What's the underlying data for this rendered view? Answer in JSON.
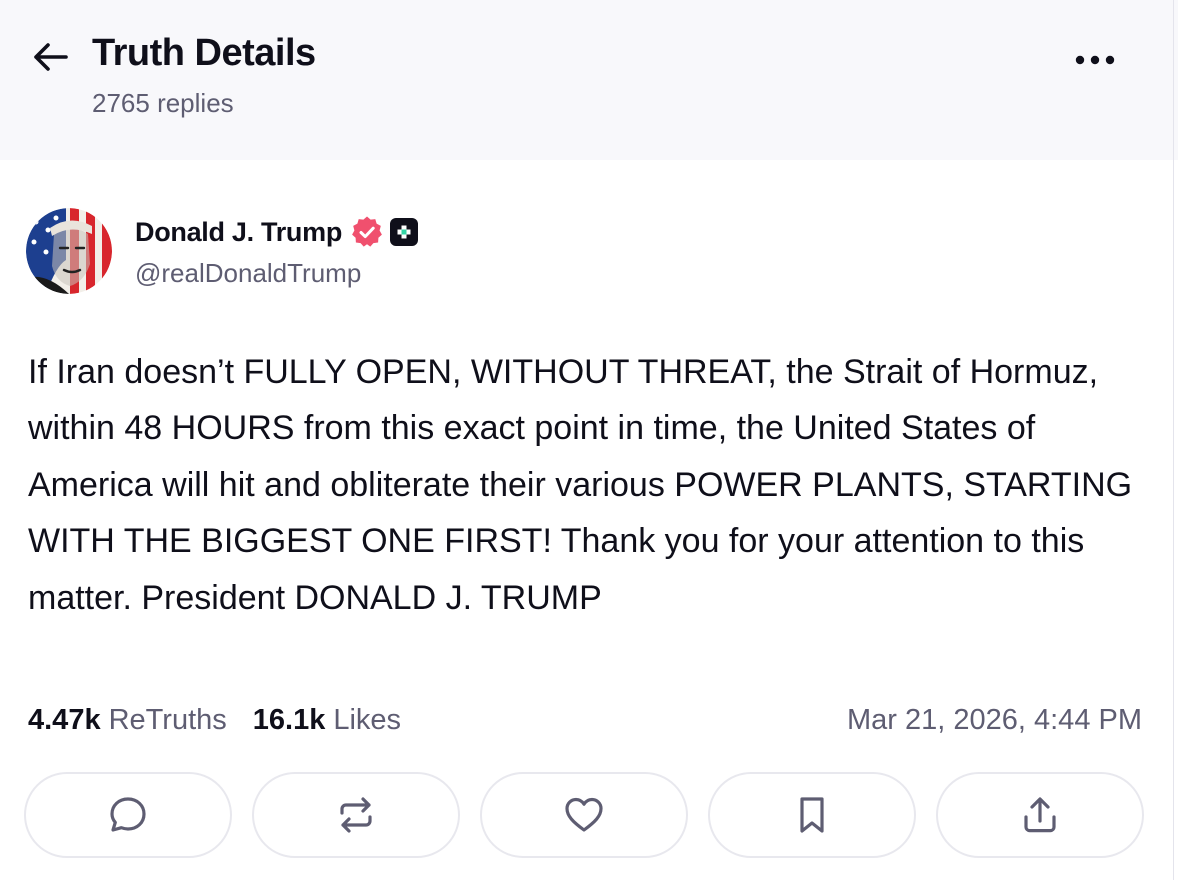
{
  "header": {
    "title": "Truth Details",
    "replies": "2765 replies",
    "back_icon": "arrow-left-icon",
    "more_icon": "more-horizontal-icon"
  },
  "author": {
    "name": "Donald J. Trump",
    "handle": "@realDonaldTrump",
    "verified_icon": "verified-badge-icon",
    "verified_color": "#f0506e",
    "plus_icon": "truth-plus-badge-icon"
  },
  "post": {
    "text": "If Iran doesn’t FULLY OPEN, WITHOUT THREAT, the Strait of Hormuz, within 48 HOURS from this exact point in time, the United States of America will hit and obliterate their various POWER PLANTS, STARTING WITH THE BIGGEST ONE FIRST! Thank you for your attention to this matter. President DONALD J. TRUMP"
  },
  "stats": {
    "retruths_count": "4.47k",
    "retruths_label": "ReTruths",
    "likes_count": "16.1k",
    "likes_label": "Likes",
    "timestamp": "Mar 21, 2026, 4:44 PM"
  },
  "actions": [
    {
      "name": "reply",
      "icon": "comment-icon"
    },
    {
      "name": "retruth",
      "icon": "repost-icon"
    },
    {
      "name": "like",
      "icon": "heart-icon"
    },
    {
      "name": "bookmark",
      "icon": "bookmark-icon"
    },
    {
      "name": "share",
      "icon": "share-icon"
    }
  ],
  "colors": {
    "text": "#0f0f1a",
    "muted": "#5e5d72",
    "header_bg": "#f8f8fb",
    "button_border": "#e8e8ee",
    "icon": "#5e5d72"
  }
}
